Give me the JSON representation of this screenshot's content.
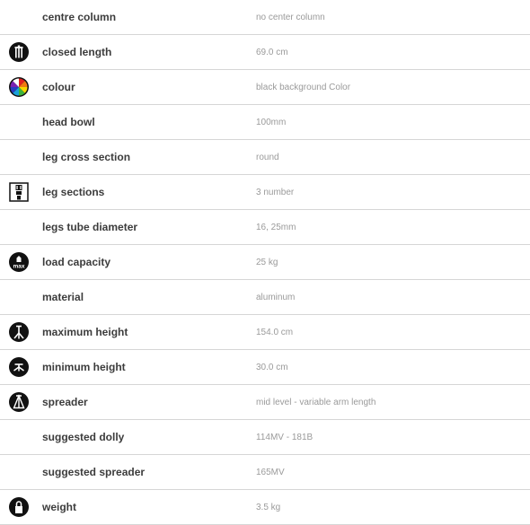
{
  "specs": [
    {
      "label": "centre column",
      "value": "no center column",
      "icon": "none"
    },
    {
      "label": "closed length",
      "value": "69.0 cm",
      "icon": "closed-length-icon"
    },
    {
      "label": "colour",
      "value": "black background Color",
      "icon": "colour-wheel-icon"
    },
    {
      "label": "head bowl",
      "value": "100mm",
      "icon": "none"
    },
    {
      "label": "leg cross section",
      "value": "round",
      "icon": "none"
    },
    {
      "label": "leg sections",
      "value": "3 number",
      "icon": "leg-sections-icon"
    },
    {
      "label": "legs tube diameter",
      "value": "16, 25mm",
      "icon": "none"
    },
    {
      "label": "load capacity",
      "value": "25 kg",
      "icon": "load-capacity-icon"
    },
    {
      "label": "material",
      "value": "aluminum",
      "icon": "none"
    },
    {
      "label": "maximum height",
      "value": "154.0 cm",
      "icon": "maximum-height-icon"
    },
    {
      "label": "minimum height",
      "value": "30.0 cm",
      "icon": "minimum-height-icon"
    },
    {
      "label": "spreader",
      "value": "mid level - variable arm length",
      "icon": "spreader-icon"
    },
    {
      "label": "suggested dolly",
      "value": "114MV - 181B",
      "icon": "none"
    },
    {
      "label": "suggested spreader",
      "value": "165MV",
      "icon": "none"
    },
    {
      "label": "weight",
      "value": "3.5 kg",
      "icon": "weight-icon"
    }
  ],
  "icons": {
    "load_capacity_text": "max"
  },
  "colors": {
    "label": "#3c3c3c",
    "value": "#9a9a9a",
    "separator": "#d6d6d6",
    "icon_bg": "#111111"
  }
}
